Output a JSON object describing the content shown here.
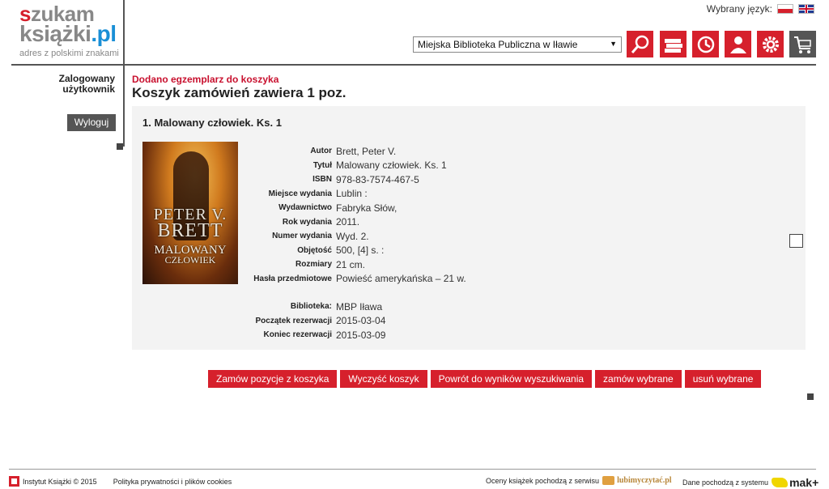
{
  "header": {
    "logo": {
      "line1": "szukam",
      "line2": "książki",
      "tld": ".pl",
      "tagline": "adres z polskimi znakami"
    },
    "language_label": "Wybrany język:",
    "languages": [
      "pl",
      "en"
    ],
    "library_select": "Miejska Biblioteka Publiczna w Iławie",
    "icons": [
      "search-icon",
      "books-icon",
      "history-icon",
      "user-icon",
      "settings-icon",
      "cart-icon"
    ]
  },
  "sidebar": {
    "logged_user": "Zalogowany użytkownik",
    "logout": "Wyloguj"
  },
  "main": {
    "message": "Dodano egzemplarz do koszyka",
    "heading": "Koszyk zamówień zawiera 1 poz.",
    "item": {
      "title": "1. Malowany człowiek. Ks. 1",
      "cover": {
        "author_first": "PETER V.",
        "author_last": "BRETT",
        "title_top": "MALOWANY",
        "title_bottom": "CZŁOWIEK"
      },
      "fields": [
        {
          "label": "Autor",
          "value": "Brett, Peter V."
        },
        {
          "label": "Tytuł",
          "value": "Malowany człowiek. Ks. 1"
        },
        {
          "label": "ISBN",
          "value": "978-83-7574-467-5"
        },
        {
          "label": "Miejsce wydania",
          "value": "Lublin :"
        },
        {
          "label": "Wydawnictwo",
          "value": "Fabryka Słów,"
        },
        {
          "label": "Rok wydania",
          "value": "2011."
        },
        {
          "label": "Numer wydania",
          "value": "Wyd. 2."
        },
        {
          "label": "Objętość",
          "value": "500, [4] s. :"
        },
        {
          "label": "Rozmiary",
          "value": "21 cm."
        },
        {
          "label": "Hasła przedmiotowe",
          "value": "Powieść amerykańska – 21 w."
        }
      ],
      "reservation": [
        {
          "label": "Biblioteka:",
          "value": "MBP Iława"
        },
        {
          "label": "Początek rezerwacji",
          "value": "2015-03-04"
        },
        {
          "label": "Koniec rezerwacji",
          "value": "2015-03-09"
        }
      ]
    },
    "actions": [
      "Zamów pozycje z koszyka",
      "Wyczyść koszyk",
      "Powrót do wyników wyszukiwania",
      "zamów wybrane",
      "usuń wybrane"
    ]
  },
  "footer": {
    "copyright": "Instytut Książki © 2015",
    "privacy": "Polityka prywatności i plików cookies",
    "ratings": "Oceny książek pochodzą z serwisu",
    "ratings_logo": "lubimyczytać.pl",
    "data_source": "Dane pochodzą z systemu",
    "data_logo": "mak+"
  }
}
